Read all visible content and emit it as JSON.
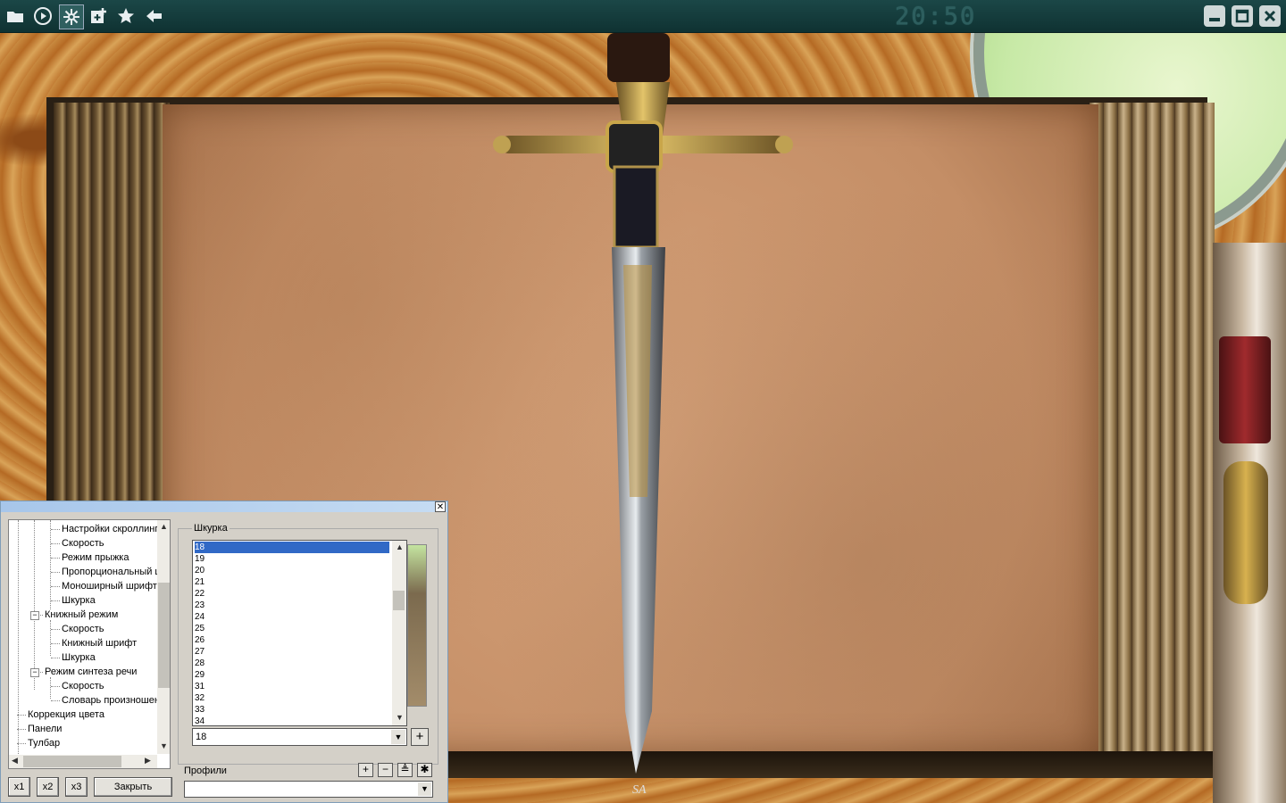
{
  "toolbar": {
    "icons": [
      "folder-icon",
      "play-icon",
      "settings-icon",
      "add-icon",
      "star-icon",
      "back-arrow-icon"
    ],
    "clock": "20:50",
    "window_icons": [
      "minimize-icon",
      "maximize-icon",
      "close-icon"
    ]
  },
  "colors": {
    "toolbar": "#133c3c",
    "selection": "#3169c6",
    "panel": "#d4d0c8"
  },
  "scene": {
    "signature": "SA"
  },
  "panel": {
    "tree": {
      "items": [
        {
          "label": "Настройки скроллинга",
          "level": 2
        },
        {
          "label": "Скорость",
          "level": 2
        },
        {
          "label": "Режим прыжка",
          "level": 2
        },
        {
          "label": "Пропорциональный шрифт",
          "level": 2
        },
        {
          "label": "Моноширный шрифт",
          "level": 2
        },
        {
          "label": "Шкурка",
          "level": 2
        },
        {
          "label": "Книжный режим",
          "level": 1,
          "expanded": true
        },
        {
          "label": "Скорость",
          "level": 2
        },
        {
          "label": "Книжный шрифт",
          "level": 2
        },
        {
          "label": "Шкурка",
          "level": 2
        },
        {
          "label": "Режим синтеза речи",
          "level": 1,
          "expanded": true
        },
        {
          "label": "Скорость",
          "level": 2
        },
        {
          "label": "Словарь произношения",
          "level": 2
        },
        {
          "label": "Коррекция цвета",
          "level": 0
        },
        {
          "label": "Панели",
          "level": 0
        },
        {
          "label": "Тулбар",
          "level": 0
        }
      ]
    },
    "buttons": {
      "x1": "x1",
      "x2": "x2",
      "x3": "x3",
      "close": "Закрыть"
    },
    "skin_group": {
      "label": "Шкурка",
      "list": [
        "18",
        "19",
        "20",
        "21",
        "22",
        "23",
        "24",
        "25",
        "26",
        "27",
        "28",
        "29",
        "31",
        "32",
        "33",
        "34"
      ],
      "selected": "18",
      "combo_value": "18",
      "add_label": "+"
    },
    "profiles": {
      "label": "Профили",
      "buttons": [
        "+",
        "−",
        "≜",
        "✱"
      ],
      "value": ""
    }
  }
}
